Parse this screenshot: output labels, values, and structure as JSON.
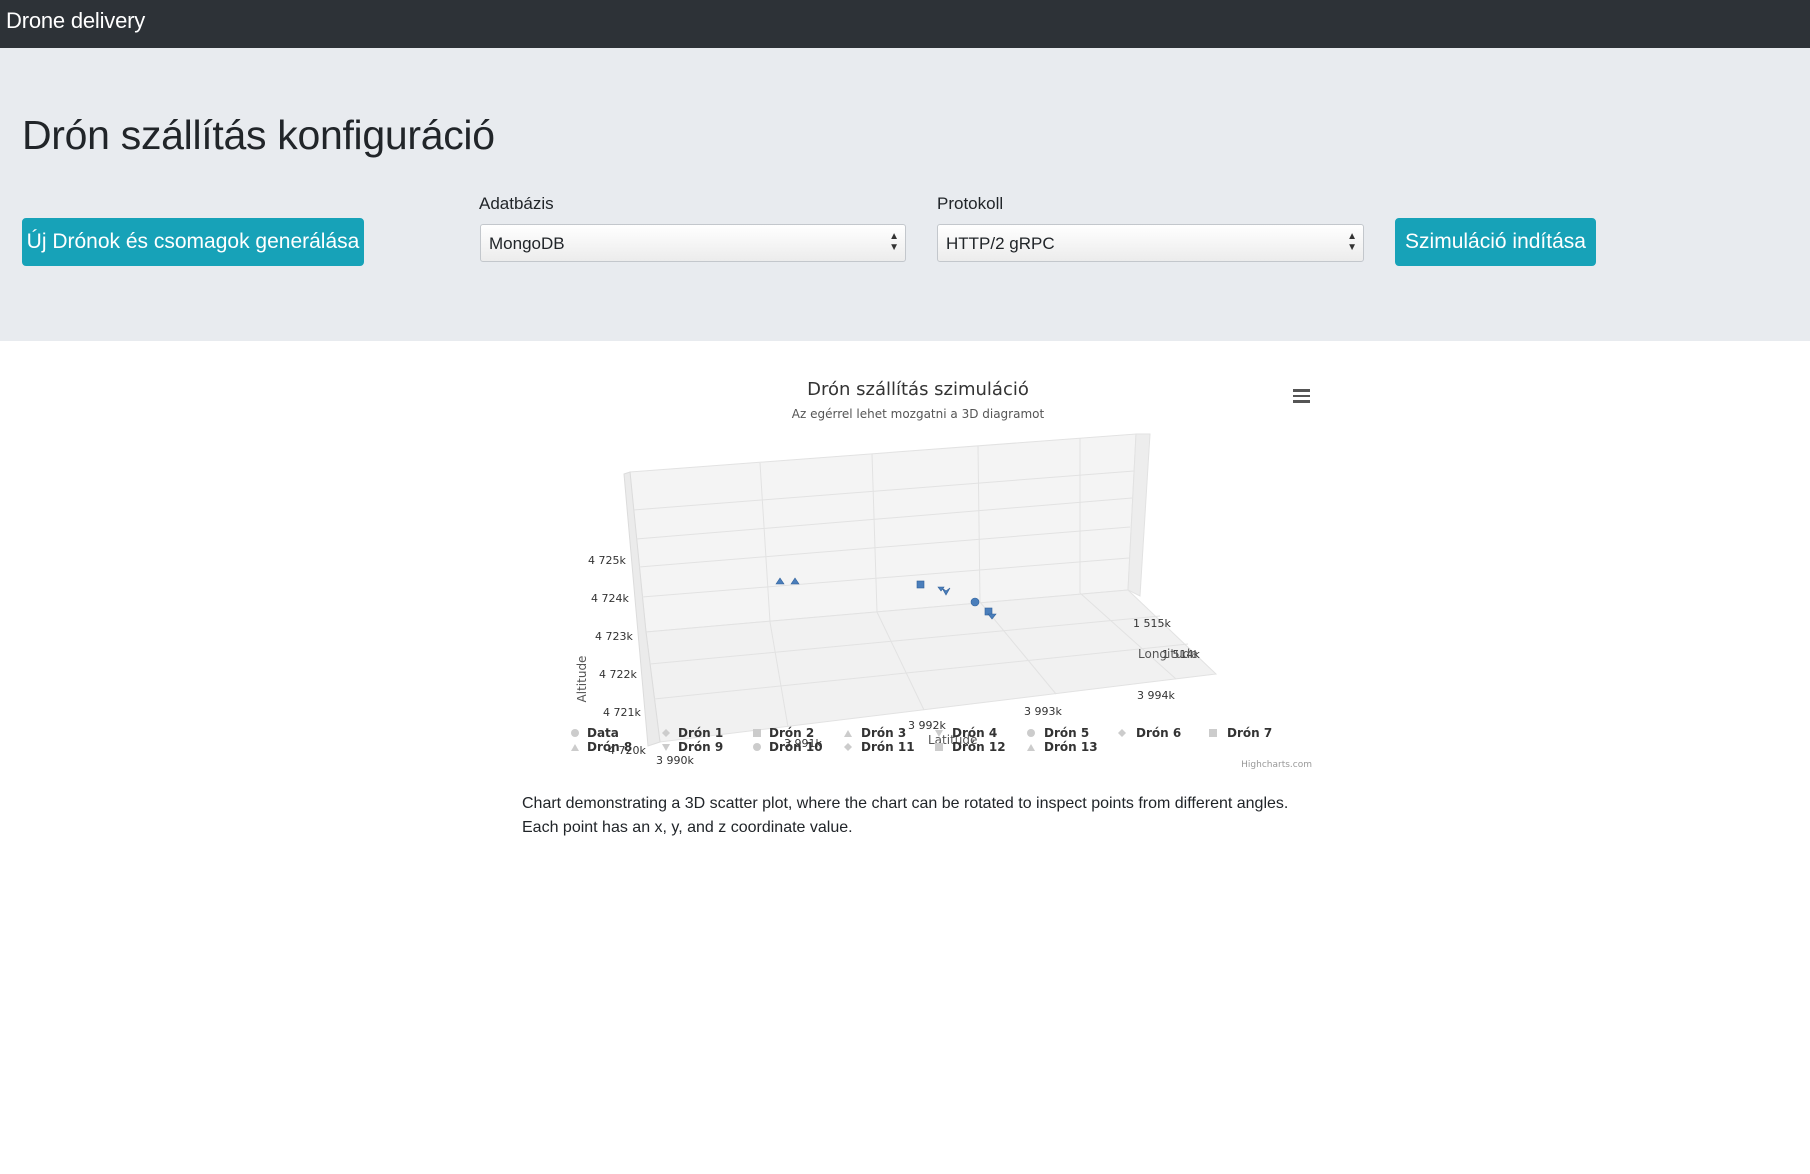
{
  "navbar": {
    "brand": "Drone delivery"
  },
  "header": {
    "title": "Drón szállítás konfiguráció",
    "generate_button": "Új Drónok és csomagok generálása",
    "start_button": "Szimuláció indítása",
    "database": {
      "label": "Adatbázis",
      "value": "MongoDB"
    },
    "protocol": {
      "label": "Protokoll",
      "value": "HTTP/2 gRPC"
    }
  },
  "chart_data": {
    "type": "scatter",
    "title": "Drón szállítás szimuláció",
    "subtitle": "Az egérrel lehet mozgatni a 3D diagramot",
    "xlabel": "Latitude",
    "ylabel": "Altitude",
    "zlabel": "Longitude",
    "x_ticks": [
      "3 990k",
      "3 991k",
      "3 992k",
      "3 993k",
      "3 994k"
    ],
    "y_ticks": [
      "4 720k",
      "4 721k",
      "4 722k",
      "4 723k",
      "4 724k",
      "4 725k"
    ],
    "z_ticks": [
      "1 514k",
      "1 515k"
    ],
    "legend": [
      "Data",
      "Drón 1",
      "Drón 2",
      "Drón 3",
      "Drón 4",
      "Drón 5",
      "Drón 6",
      "Drón 7",
      "Drón 8",
      "Drón 9",
      "Drón 10",
      "Drón 11",
      "Drón 12",
      "Drón 13"
    ],
    "legend_position": "bottom",
    "grid": true,
    "point_color": "#4a7ebb",
    "credits": "Highcharts.com"
  },
  "caption": "Chart demonstrating a 3D scatter plot, where the chart can be rotated to inspect points from different angles. Each point has an x, y, and z coordinate value."
}
